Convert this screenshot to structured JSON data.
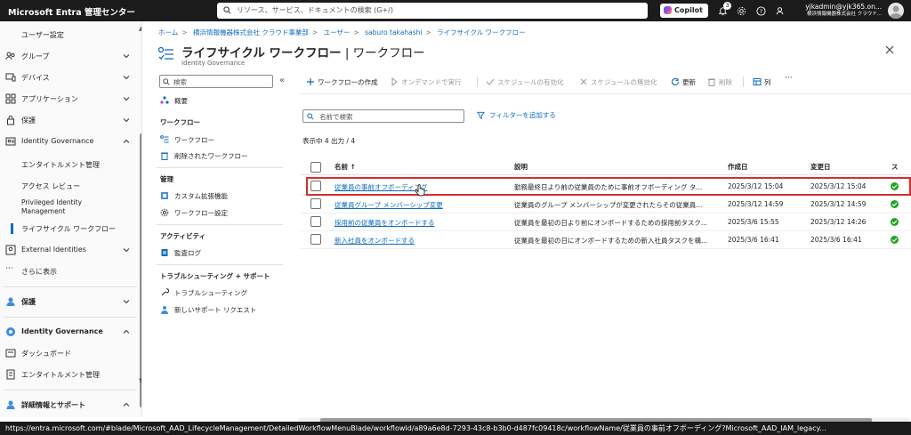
{
  "topbar": {
    "brand": "Microsoft Entra 管理センター",
    "search_placeholder": "リソース、サービス、ドキュメントの検索 (G+/)",
    "copilot_label": "Copilot",
    "notification_count": "3",
    "user_email": "yjkadmin@yjk365.on...",
    "user_tenant": "横浜情報機器株式会社 クラウド..."
  },
  "leftnav": {
    "items": [
      {
        "label": "ユーザー設定",
        "icon": "none"
      },
      {
        "label": "グループ",
        "icon": "group-icon"
      },
      {
        "label": "デバイス",
        "icon": "device-icon"
      },
      {
        "label": "アプリケーション",
        "icon": "apps-icon"
      },
      {
        "label": "保護",
        "icon": "lock-icon"
      },
      {
        "label": "Identity Governance",
        "icon": "governance-icon"
      },
      {
        "label": "エンタイトルメント管理",
        "icon": "none"
      },
      {
        "label": "アクセス レビュー",
        "icon": "none"
      },
      {
        "label": "Privileged Identity Management",
        "icon": "none"
      },
      {
        "label": "ライフサイクル ワークフロー",
        "icon": "none"
      },
      {
        "label": "External Identities",
        "icon": "external-icon"
      },
      {
        "label": "さらに表示",
        "icon": "more-icon"
      },
      {
        "label": "保護",
        "icon": "protection-icon"
      },
      {
        "label": "Identity Governance",
        "icon": "governance-icon"
      },
      {
        "label": "ダッシュボード",
        "icon": "dashboard-icon"
      },
      {
        "label": "エンタイトルメント管理",
        "icon": "entitlement-icon"
      },
      {
        "label": "詳細情報とサポート",
        "icon": "support-icon"
      }
    ]
  },
  "breadcrumb": [
    "ホーム",
    "横浜情報機器株式会社 クラウド事業部",
    "ユーザー",
    "saburo takahashi",
    "ライフサイクル ワークフロー"
  ],
  "page": {
    "title": "ライフサイクル ワークフロー",
    "title_suffix": " | ワークフロー",
    "subtitle": "Identity Governance",
    "more": "···"
  },
  "resource_menu": {
    "search_placeholder": "検索",
    "overview": "概要",
    "section_workflow": "ワークフロー",
    "workflows": "ワークフロー",
    "deleted_workflows": "削除されたワークフロー",
    "section_manage": "管理",
    "custom_extensions": "カスタム拡張機能",
    "workflow_settings": "ワークフロー設定",
    "section_activity": "アクティビティ",
    "audit_logs": "監査ログ",
    "section_troubleshoot": "トラブルシューティング + サポート",
    "troubleshooting": "トラブルシューティング",
    "new_support_request": "新しいサポート リクエスト"
  },
  "toolbar": {
    "create": "ワークフローの作成",
    "run_on_demand": "オンデマンドで実行",
    "enable_schedule": "スケジュールの有効化",
    "disable_schedule": "スケジュールの無効化",
    "refresh": "更新",
    "delete": "削除",
    "columns": "列",
    "more": "···"
  },
  "filter": {
    "search_placeholder": "名前で検索",
    "add_filter": "フィルターを追加する",
    "count_text": "表示中 4 出力 / 4"
  },
  "table": {
    "columns": [
      "名前 ↑",
      "説明",
      "作成日",
      "変更日",
      "ス"
    ],
    "rows": [
      {
        "name": "従業員の事前オフボーディング",
        "description": "勤務最終日より前の従業員のために事前オフボーディング タ...",
        "created": "2025/3/12 15:04",
        "modified": "2025/3/12 15:04",
        "status": "enabled"
      },
      {
        "name": "従業員グループ メンバーシップ変更",
        "description": "従業員のグループ メンバーシップが変更されたらその従業員...",
        "created": "2025/3/12 14:59",
        "modified": "2025/3/12 14:59",
        "status": "enabled"
      },
      {
        "name": "採用前の従業員をオンボードする",
        "description": "従業員を最初の日より前にオンボードするための採用前タスク...",
        "created": "2025/3/6 15:55",
        "modified": "2025/3/12 14:26",
        "status": "enabled"
      },
      {
        "name": "新入社員をオンボードする",
        "description": "従業員を最初の日にオンボードするための新入社員タスクを構...",
        "created": "2025/3/6 16:41",
        "modified": "2025/3/6 16:41",
        "status": "enabled"
      }
    ]
  },
  "statusbar": {
    "url": "https://entra.microsoft.com/#blade/Microsoft_AAD_LifecycleManagement/DetailedWorkflowMenuBlade/workflowId/a89a6e8d-7293-43c8-b3b0-d487fc09418c/workflowName/従業員の事前オフボーディング?Microsoft_AAD_IAM_legacy..."
  }
}
